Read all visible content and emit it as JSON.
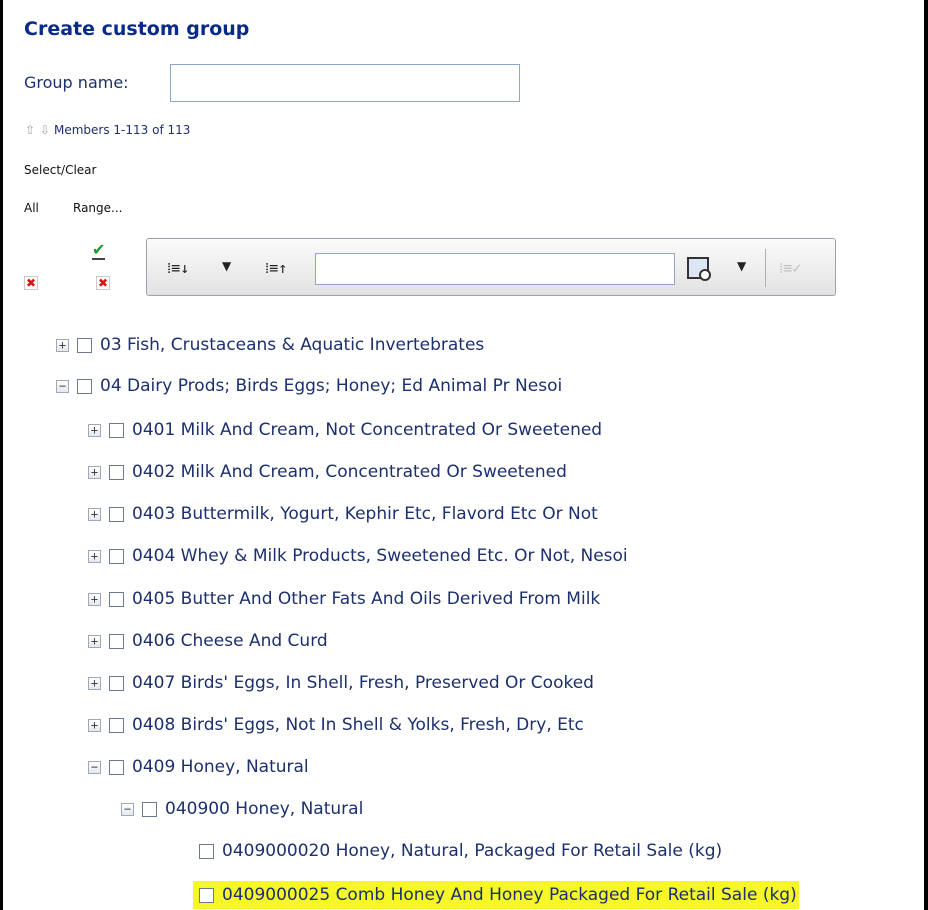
{
  "title": "Create custom group",
  "group_name": {
    "label": "Group name:",
    "value": ""
  },
  "members": {
    "text": "Members 1-113 of 113",
    "up_icon": "arrow-up-icon",
    "down_icon": "arrow-down-icon"
  },
  "select_clear": {
    "label": "Select/Clear",
    "all": "All",
    "range": "Range..."
  },
  "toolbar": {
    "search_value": ""
  },
  "tree": [
    {
      "label": "03 Fish, Crustaceans & Aquatic Invertebrates",
      "expander": "+"
    },
    {
      "label": "04 Dairy Prods; Birds Eggs; Honey; Ed Animal Pr Nesoi",
      "expander": "−"
    },
    {
      "label": "0401 Milk And Cream, Not Concentrated Or Sweetened",
      "expander": "+"
    },
    {
      "label": "0402 Milk And Cream, Concentrated Or Sweetened",
      "expander": "+"
    },
    {
      "label": "0403 Buttermilk, Yogurt, Kephir Etc, Flavord Etc Or Not",
      "expander": "+"
    },
    {
      "label": "0404 Whey & Milk Products, Sweetened Etc. Or Not, Nesoi",
      "expander": "+"
    },
    {
      "label": "0405 Butter And Other Fats And Oils Derived From Milk",
      "expander": "+"
    },
    {
      "label": "0406 Cheese And Curd",
      "expander": "+"
    },
    {
      "label": "0407 Birds' Eggs, In Shell, Fresh, Preserved Or Cooked",
      "expander": "+"
    },
    {
      "label": "0408 Birds' Eggs, Not In Shell & Yolks, Fresh, Dry, Etc",
      "expander": "+"
    },
    {
      "label": "0409 Honey, Natural",
      "expander": "−"
    },
    {
      "label": "040900 Honey, Natural",
      "expander": "−"
    },
    {
      "label": "0409000020 Honey, Natural, Packaged For Retail Sale (kg)",
      "expander": ""
    },
    {
      "label": "0409000025 Comb Honey And Honey Packaged For Retail Sale (kg)",
      "expander": ""
    }
  ],
  "colors": {
    "title": "#0a2a8a",
    "text": "#1c2f6e",
    "highlight": "#f7f728"
  }
}
